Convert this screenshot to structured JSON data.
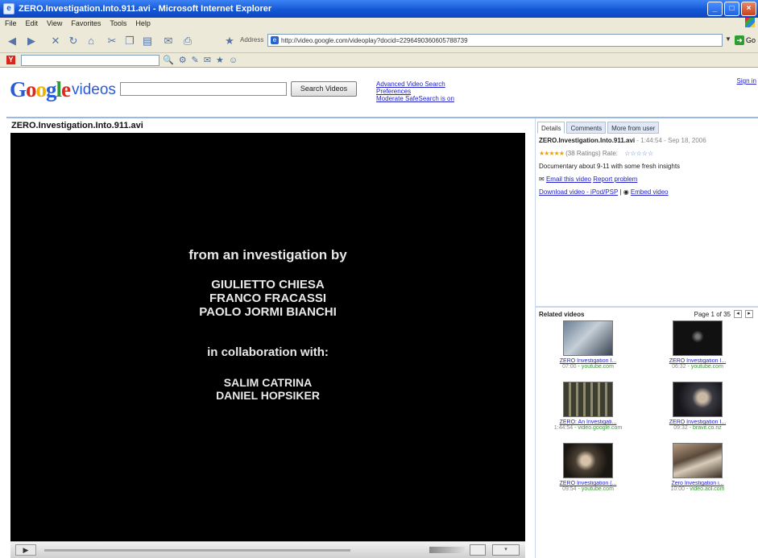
{
  "window": {
    "title": "ZERO.Investigation.Into.911.avi - Microsoft Internet Explorer",
    "menu": [
      "File",
      "Edit",
      "View",
      "Favorites",
      "Tools",
      "Help"
    ],
    "address_label": "Address",
    "address_url": "http://video.google.com/videoplay?docid=2296490360605788739",
    "go_label": "Go"
  },
  "google": {
    "logo_letters": [
      "G",
      "o",
      "o",
      "g",
      "l",
      "e"
    ],
    "product": "videos",
    "search_value": "",
    "search_button": "Search Videos",
    "links": [
      "Advanced Video Search",
      "Preferences",
      "Moderate SafeSearch is on"
    ],
    "sign_in": "Sign in"
  },
  "video": {
    "title": "ZERO.Investigation.Into.911.avi",
    "credits": {
      "lead": "from an investigation by",
      "names": [
        "GIULIETTO CHIESA",
        "FRANCO FRACASSI",
        "PAOLO JORMI BIANCHI"
      ],
      "collab": "in collaboration with:",
      "names2": [
        "SALIM CATRINA",
        "DANIEL HOPSIKER"
      ]
    }
  },
  "details": {
    "tabs": [
      "Details",
      "Comments",
      "More from user"
    ],
    "title": "ZERO.Investigation.Into.911.avi",
    "meta": "- 1:44:54 - Sep 18, 2006",
    "stars": "★★★★★",
    "ratings": "(38 Ratings) Rate:",
    "rate_label": "☆☆☆☆☆",
    "description": "Documentary about 9-11 with some fresh insights",
    "email_link": "Email this video",
    "report_link": "Report problem",
    "download_link": "Download video - iPod/PSP",
    "embed_link": "Embed video"
  },
  "related": {
    "heading": "Related videos",
    "page": "Page 1 of 35",
    "items": [
      {
        "title": "ZERO Investigation I...",
        "duration": "07:00",
        "source": "youtube.com"
      },
      {
        "title": "ZERO Investigation I...",
        "duration": "06:32",
        "source": "youtube.com"
      },
      {
        "title": "ZERO: An Investigati...",
        "duration": "1:44:54",
        "source": "video.google.com"
      },
      {
        "title": "ZERO Investigation I...",
        "duration": "09:32",
        "source": "bravit.co.nz"
      },
      {
        "title": "ZERO Investigation (...",
        "duration": "09:54",
        "source": "youtube.com"
      },
      {
        "title": "Zero Investigation i...",
        "duration": "10:00",
        "source": "video.aol.com"
      }
    ]
  },
  "colors": {
    "titlebar": "#1457d6",
    "link": "#2222cc",
    "source": "#3c9a3c",
    "star": "#e9a400"
  }
}
